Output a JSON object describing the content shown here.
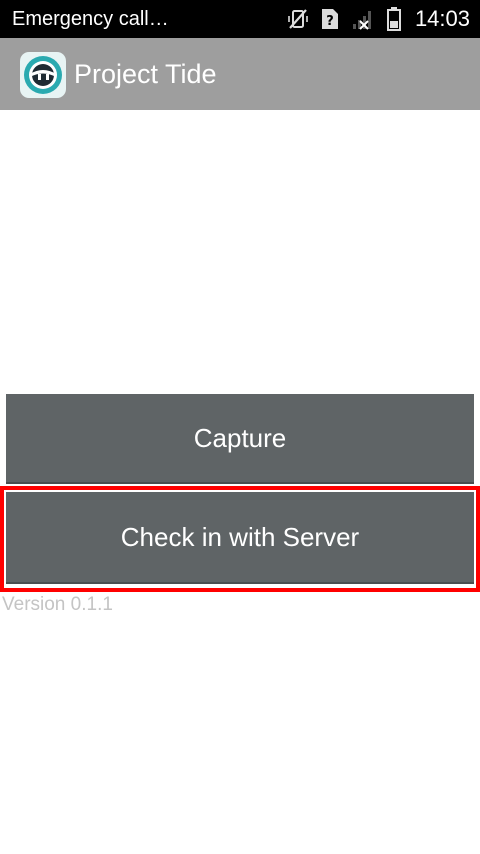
{
  "status_bar": {
    "carrier_text": "Emergency call…",
    "time": "14:03",
    "icons": [
      "vibrate-off-icon",
      "sim-unknown-icon",
      "no-signal-icon",
      "battery-icon"
    ]
  },
  "action_bar": {
    "title": "Project Tide",
    "logo_icon": "project-tide-logo"
  },
  "main": {
    "capture_label": "Capture",
    "check_in_label": "Check in with Server",
    "version_text": "Version 0.1.1"
  },
  "colors": {
    "status_bar_bg": "#000000",
    "action_bar_bg": "#9e9e9e",
    "button_bg": "#5f6466",
    "highlight": "#ff0000",
    "version_text": "#c4c4c4",
    "logo_accent": "#2aaab0"
  }
}
